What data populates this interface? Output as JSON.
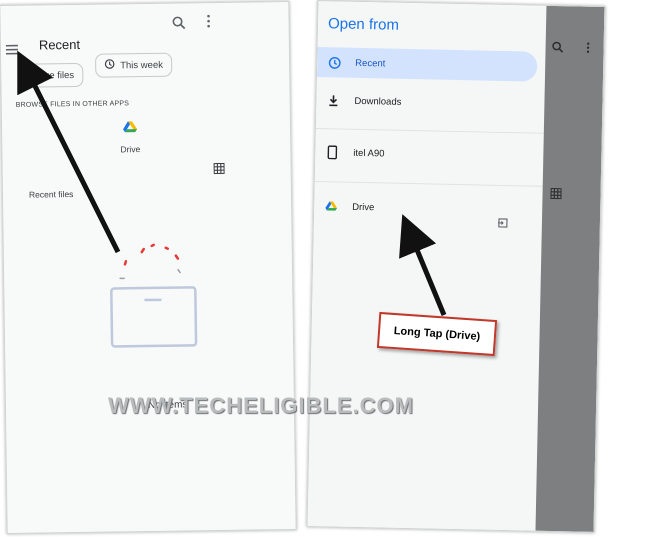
{
  "left_screen": {
    "title": "Recent",
    "chips": [
      {
        "label": "Large files",
        "icon": "file-icon"
      },
      {
        "label": "This week",
        "icon": "history-icon"
      }
    ],
    "browse_section_label": "BROWSE FILES IN OTHER APPS",
    "apps": [
      {
        "label": "Drive",
        "icon": "drive-icon"
      }
    ],
    "recent_files_label": "Recent files",
    "empty_message": "No items"
  },
  "right_screen": {
    "drawer_title": "Open from",
    "items": [
      {
        "label": "Recent",
        "icon": "clock-icon",
        "selected": true
      },
      {
        "label": "Downloads",
        "icon": "download-icon",
        "selected": false
      },
      {
        "label": "itel A90",
        "icon": "phone-icon",
        "selected": false
      },
      {
        "label": "Drive",
        "icon": "drive-icon",
        "selected": false
      }
    ]
  },
  "annotation": {
    "callout": "Long Tap (Drive)"
  },
  "watermark": "WWW.TECHELIGIBLE.COM",
  "colors": {
    "accent_blue": "#1a73e8",
    "selected_bg": "#d3e3fd",
    "callout_border": "#c0392b",
    "arrow": "#111111",
    "loading_red": "#e53935"
  }
}
